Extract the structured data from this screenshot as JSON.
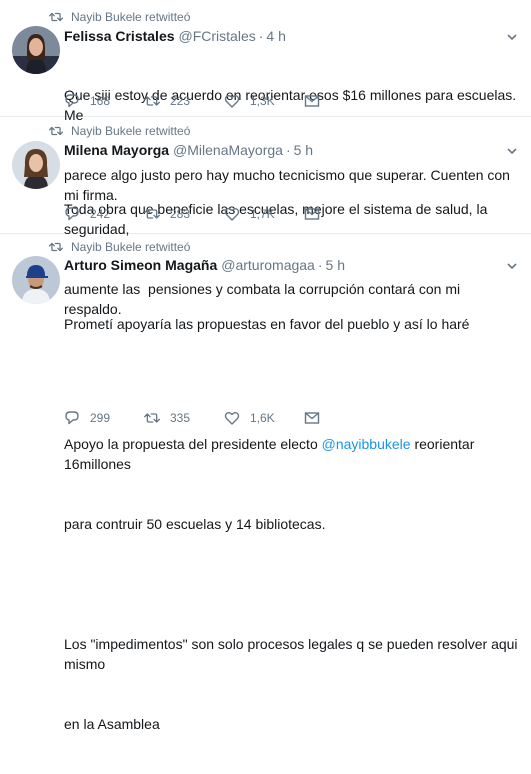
{
  "tweets": [
    {
      "retweet_context": "Nayib Bukele retwitteó",
      "fullname": "Felissa Cristales",
      "username": "@FCristales",
      "separator": "·",
      "time": "4 h",
      "lines": [
        "Que siii estoy de acuerdo en reorientar esos $16 millones para escuelas. Me",
        "parece algo justo pero hay mucho tecnicismo que superar. Cuenten con mi firma."
      ],
      "replies": "168",
      "retweets": "223",
      "likes": "1,3K"
    },
    {
      "retweet_context": "Nayib Bukele retwitteó",
      "fullname": "Milena Mayorga",
      "username": "@MilenaMayorga",
      "separator": "·",
      "time": "5 h",
      "lines": [
        "Toda obra que beneficie las escuelas, mejore el sistema de salud, la seguridad,",
        "aumente las  pensiones y combata la corrupción contará con mi respaldo."
      ],
      "replies": "242",
      "retweets": "283",
      "likes": "1,7K"
    },
    {
      "retweet_context": "Nayib Bukele retwitteó",
      "fullname": "Arturo Simeon Magaña",
      "username": "@arturomagaa",
      "separator": "·",
      "time": "5 h",
      "line1": "Prometí apoyaría las propuestas en favor del pueblo y así lo haré",
      "line2_pre": "Apoyo la propuesta del presidente electo ",
      "mention": "@nayibbukele",
      "line2_post": " reorientar 16millones",
      "line3": "para contruir 50 escuelas y 14 bibliotecas.",
      "line4": "Los \"impedimentos\" son solo procesos legales q se pueden resolver aqui mismo",
      "line5": "en la Asamblea",
      "replies": "299",
      "retweets": "335",
      "likes": "1,6K"
    }
  ],
  "colors": {
    "secondary_text": "#657786",
    "link": "#1b95e0",
    "border": "#e6ecf0"
  },
  "icons": [
    "retweet-icon",
    "reply-icon",
    "like-icon",
    "direct-message-icon",
    "caret-down-icon"
  ]
}
